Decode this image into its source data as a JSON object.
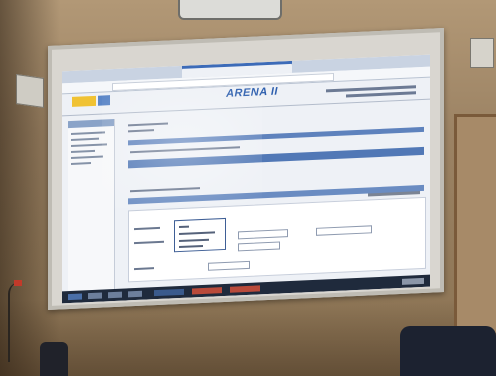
{
  "photo": {
    "subject": "projected-web-application-on-classroom-whiteboard"
  },
  "screen": {
    "app_title": "ARENA II"
  },
  "colors": {
    "wall": "#9c8364",
    "board_frame": "#bfbcb4",
    "app_blue": "#5178b6",
    "title_blue": "#2e5fae",
    "taskbar": "#1f2a3c",
    "logo_yellow": "#f0c233"
  },
  "icons": {
    "projector": "ceiling-projector-icon",
    "camera": "wall-camera-icon",
    "speaker": "wall-speaker-icon"
  }
}
